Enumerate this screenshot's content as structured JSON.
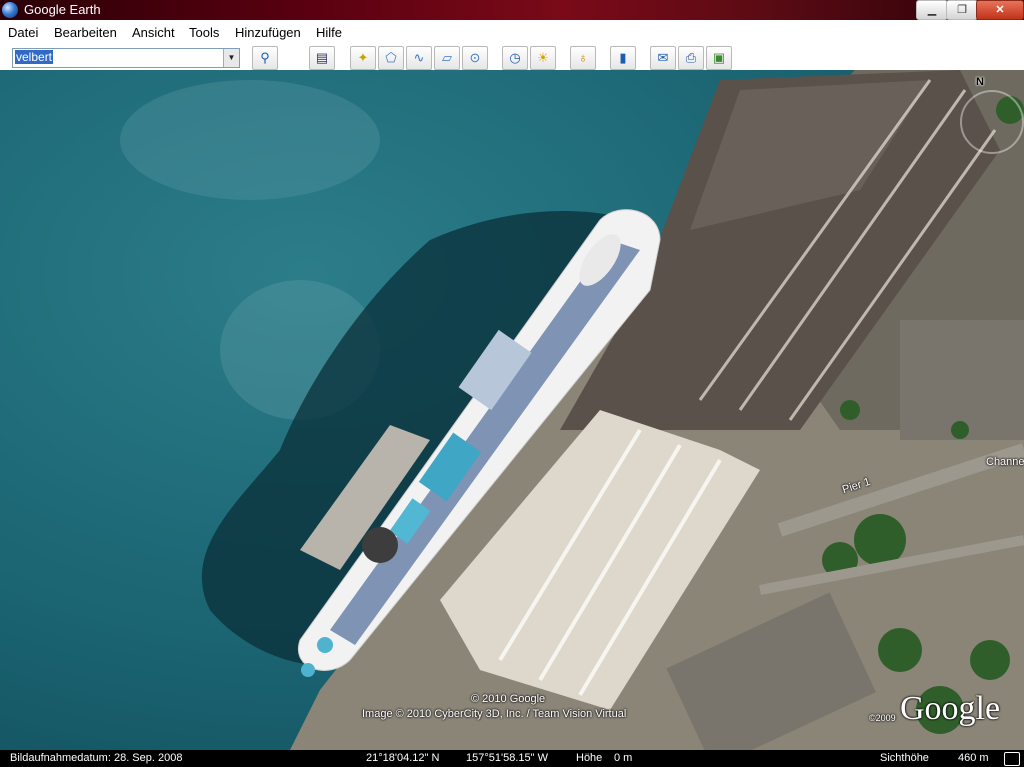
{
  "window": {
    "title": "Google Earth"
  },
  "menu": [
    "Datei",
    "Bearbeiten",
    "Ansicht",
    "Tools",
    "Hinzufügen",
    "Hilfe"
  ],
  "search": {
    "value": "velbert"
  },
  "map": {
    "north_label": "N",
    "labels": {
      "channel": "Channe",
      "pier": "Pier 1"
    },
    "copyright_1": "© 2010 Google",
    "copyright_2": "Image © 2010 CyberCity 3D, Inc. / Team Vision Virtual",
    "logo": "Google",
    "logo_year": "©2009"
  },
  "status": {
    "date_label": "Bildaufnahmedatum: 28. Sep. 2008",
    "lat": "21°18'04.12\" N",
    "lon": "157°51'58.15\" W",
    "height_label": "Höhe",
    "height_value": "0 m",
    "eye_label": "Sichthöhe",
    "eye_value": "460 m"
  },
  "colors": {
    "water": "#1f6a78",
    "roof_dark": "#5b514b",
    "roof_light": "#ddd7cc",
    "title_bar": "#6a0b16"
  }
}
